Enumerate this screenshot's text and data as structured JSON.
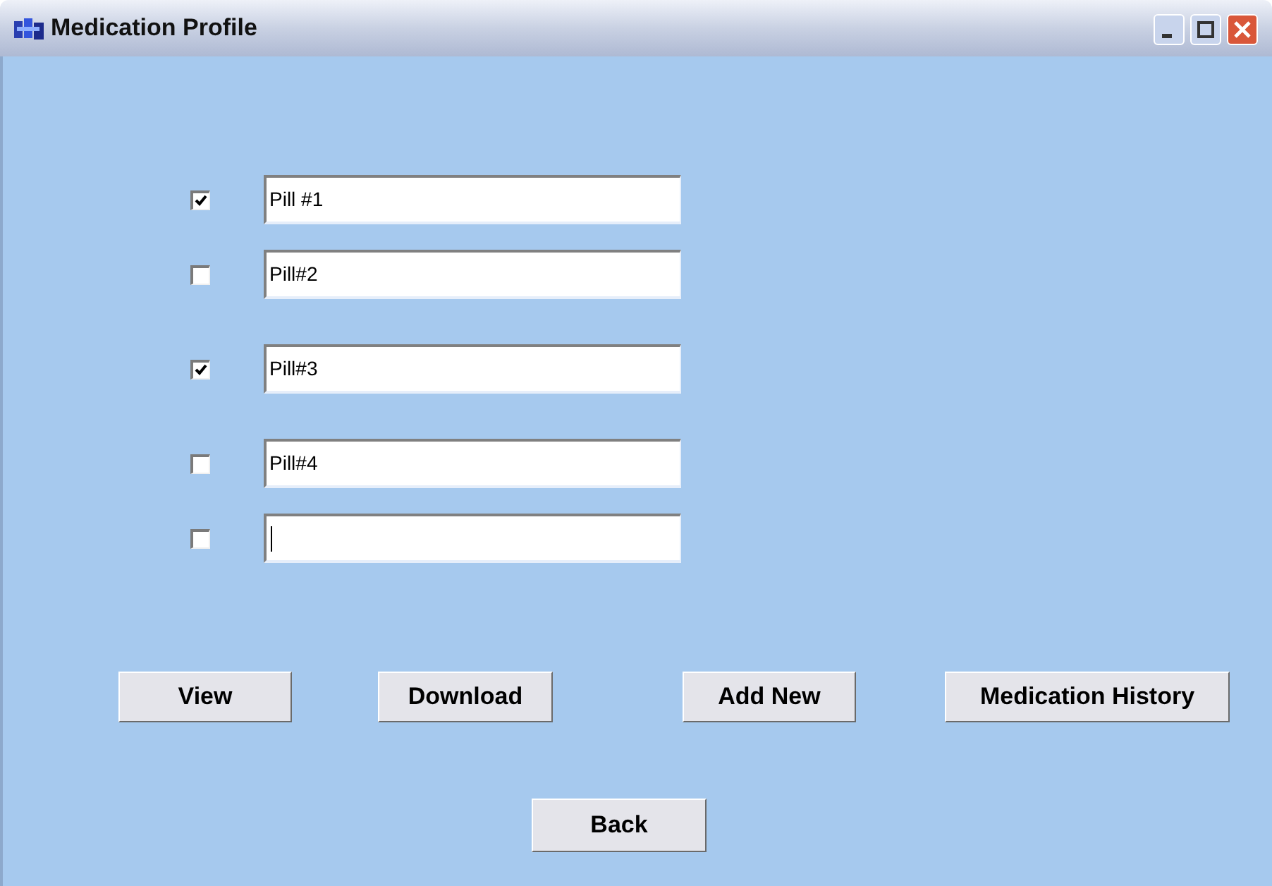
{
  "window": {
    "title": "Medication Profile"
  },
  "medications": [
    {
      "checked": true,
      "value": "Pill #1",
      "focused": false
    },
    {
      "checked": false,
      "value": "Pill#2",
      "focused": false
    },
    {
      "checked": true,
      "value": "Pill#3",
      "focused": false
    },
    {
      "checked": false,
      "value": "Pill#4",
      "focused": false
    },
    {
      "checked": false,
      "focused": true
    }
  ],
  "buttons": [
    "View",
    "Download",
    "Add New",
    "Medication History"
  ],
  "back_button": "Back"
}
